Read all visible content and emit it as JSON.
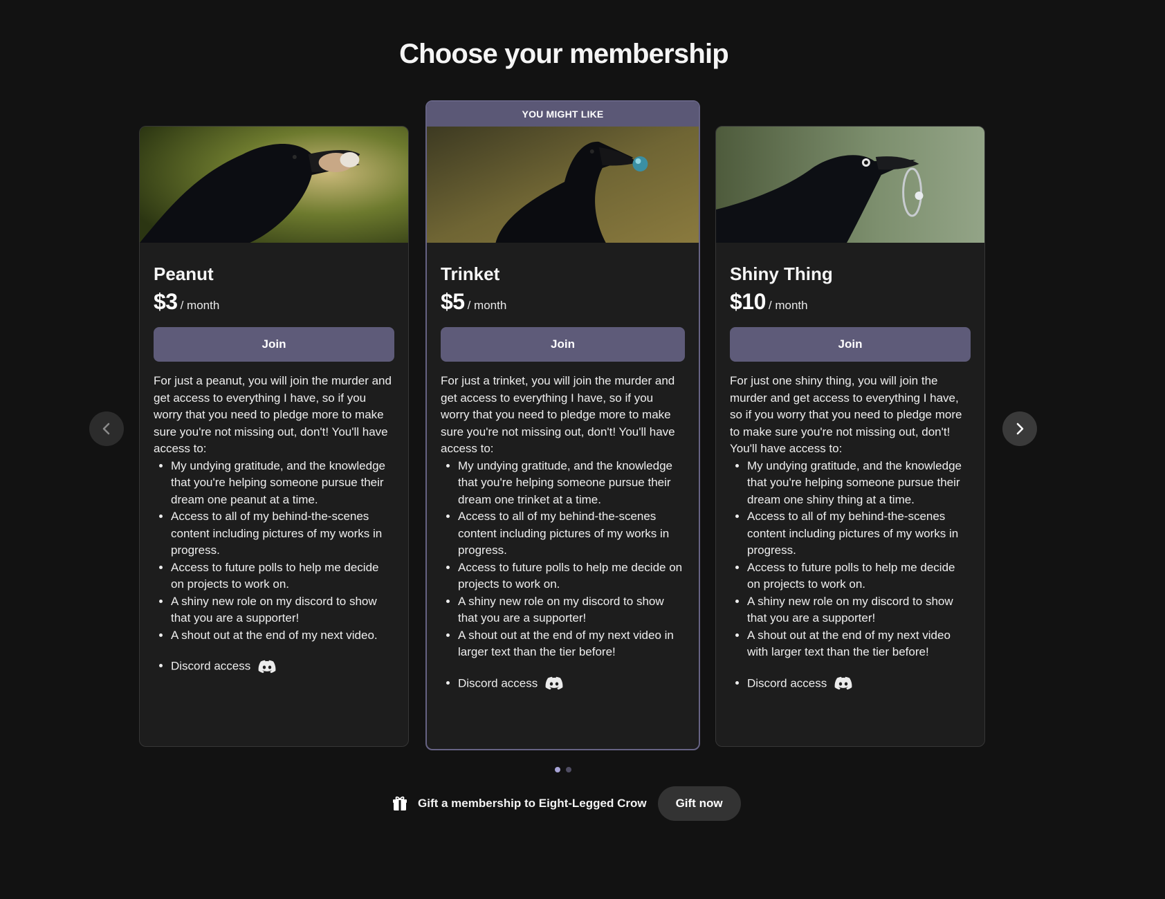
{
  "page": {
    "title": "Choose your membership"
  },
  "tiers": [
    {
      "name": "Peanut",
      "price": "$3",
      "period": "/ month",
      "join_label": "Join",
      "featured": false,
      "image_icon": "crow-with-peanut-image",
      "description": "For just a peanut, you will join the murder and get access to everything I have, so if you worry that you need to pledge more to make sure you're not missing out, don't! You'll have access to:",
      "benefits": [
        "My undying gratitude, and the knowledge that you're helping someone pursue their dream one peanut at a time.",
        "Access to all of my behind-the-scenes content including pictures of my works in progress.",
        "Access to future polls to help me decide on projects to work on.",
        "A shiny new role on my discord to show that you are a supporter!",
        "A shout out at the end of my next video."
      ],
      "discord_label": "Discord access"
    },
    {
      "name": "Trinket",
      "price": "$5",
      "period": "/ month",
      "join_label": "Join",
      "featured": true,
      "banner": "YOU MIGHT LIKE",
      "image_icon": "crow-with-marble-image",
      "description": "For just a trinket, you will join the murder and get access to everything I have, so if you worry that you need to pledge more to make sure you're not missing out, don't! You'll have access to:",
      "benefits": [
        "My undying gratitude, and the knowledge that you're helping someone pursue their dream one trinket at a time.",
        "Access to all of my behind-the-scenes content including pictures of my works in progress.",
        "Access to future polls to help me decide on projects to work on.",
        "A shiny new role on my discord to show that you are a supporter!",
        "A shout out at the end of my next video in larger text than the tier before!"
      ],
      "discord_label": "Discord access"
    },
    {
      "name": "Shiny Thing",
      "price": "$10",
      "period": "/ month",
      "join_label": "Join",
      "featured": false,
      "image_icon": "crow-with-ring-image",
      "description": "For just one shiny thing, you will join the murder and get access to everything I have, so if you worry that you need to pledge more to make sure you're not missing out, don't! You'll have access to:",
      "benefits": [
        "My undying gratitude, and the knowledge that you're helping someone pursue their dream one shiny thing at a time.",
        "Access to all of my behind-the-scenes content including pictures of my works in progress.",
        "Access to future polls to help me decide on projects to work on.",
        "A shiny new role on my discord to show that you are a supporter!",
        "A shout out at the end of my next video with larger text than the tier before!"
      ],
      "discord_label": "Discord access"
    }
  ],
  "carousel": {
    "prev_icon": "chevron-left-icon",
    "next_icon": "chevron-right-icon",
    "page_count": 2,
    "active_page": 1
  },
  "gift": {
    "icon": "gift-icon",
    "text": "Gift a membership to Eight-Legged Crow",
    "button_label": "Gift now"
  },
  "colors": {
    "background": "#121212",
    "card": "#1d1d1d",
    "accent": "#5e5b79",
    "featured_border": "#666384",
    "dot_active": "#a7a4d6"
  }
}
